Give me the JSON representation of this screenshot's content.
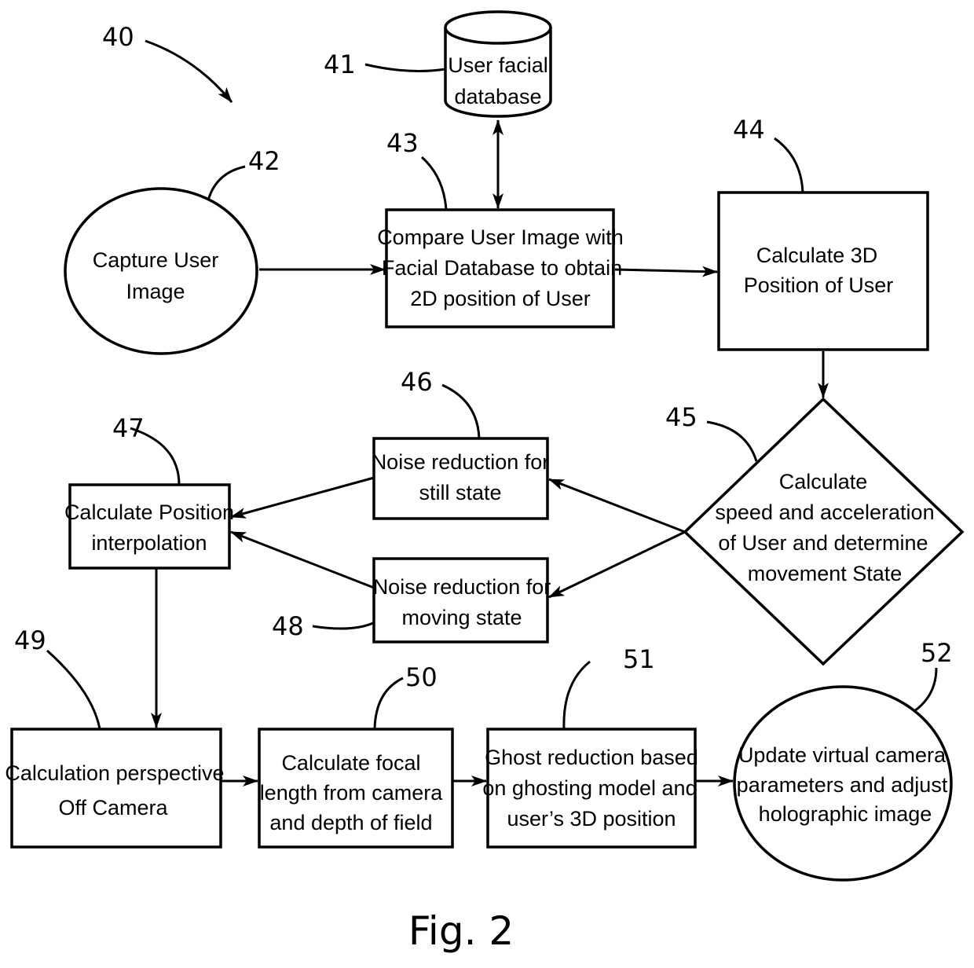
{
  "figure": {
    "caption": "Fig. 2",
    "ref_main": "40"
  },
  "nodes": {
    "database": {
      "ref": "41",
      "shape": "cylinder",
      "lines": [
        "User facial",
        "database"
      ]
    },
    "capture": {
      "ref": "42",
      "shape": "ellipse",
      "lines": [
        "Capture User",
        "Image"
      ]
    },
    "compare": {
      "ref": "43",
      "shape": "rect",
      "lines": [
        "Compare User Image with",
        "Facial Database to obtain",
        "2D position of User"
      ]
    },
    "calc3d": {
      "ref": "44",
      "shape": "rect",
      "lines": [
        "Calculate 3D",
        "Position of User"
      ]
    },
    "decision": {
      "ref": "45",
      "shape": "diamond",
      "lines": [
        "Calculate",
        "speed and acceleration",
        "of User and determine",
        "movement  State"
      ]
    },
    "still": {
      "ref": "46",
      "shape": "rect",
      "lines": [
        "Noise reduction for",
        "still state"
      ]
    },
    "interp": {
      "ref": "47",
      "shape": "rect",
      "lines": [
        "Calculate Position",
        "interpolation"
      ]
    },
    "moving": {
      "ref": "48",
      "shape": "rect",
      "lines": [
        "Noise reduction for",
        "moving state"
      ]
    },
    "perspective": {
      "ref": "49",
      "shape": "rect",
      "lines": [
        "Calculation perspective",
        "Off Camera"
      ]
    },
    "focal": {
      "ref": "50",
      "shape": "rect",
      "lines": [
        "Calculate focal",
        "length from camera",
        "and depth of field"
      ]
    },
    "ghost": {
      "ref": "51",
      "shape": "rect",
      "lines": [
        "Ghost reduction based",
        "on ghosting model and",
        "user’s 3D position"
      ]
    },
    "update": {
      "ref": "52",
      "shape": "ellipse",
      "lines": [
        "Update virtual camera",
        "parameters and adjust",
        "holographic image"
      ]
    }
  },
  "edges": [
    {
      "from": "capture",
      "to": "compare"
    },
    {
      "from": "compare",
      "to": "database",
      "bidirectional": true
    },
    {
      "from": "compare",
      "to": "calc3d"
    },
    {
      "from": "calc3d",
      "to": "decision"
    },
    {
      "from": "decision",
      "to": "still"
    },
    {
      "from": "decision",
      "to": "moving"
    },
    {
      "from": "still",
      "to": "interp"
    },
    {
      "from": "moving",
      "to": "interp"
    },
    {
      "from": "interp",
      "to": "perspective"
    },
    {
      "from": "perspective",
      "to": "focal"
    },
    {
      "from": "focal",
      "to": "ghost"
    },
    {
      "from": "ghost",
      "to": "update"
    }
  ]
}
